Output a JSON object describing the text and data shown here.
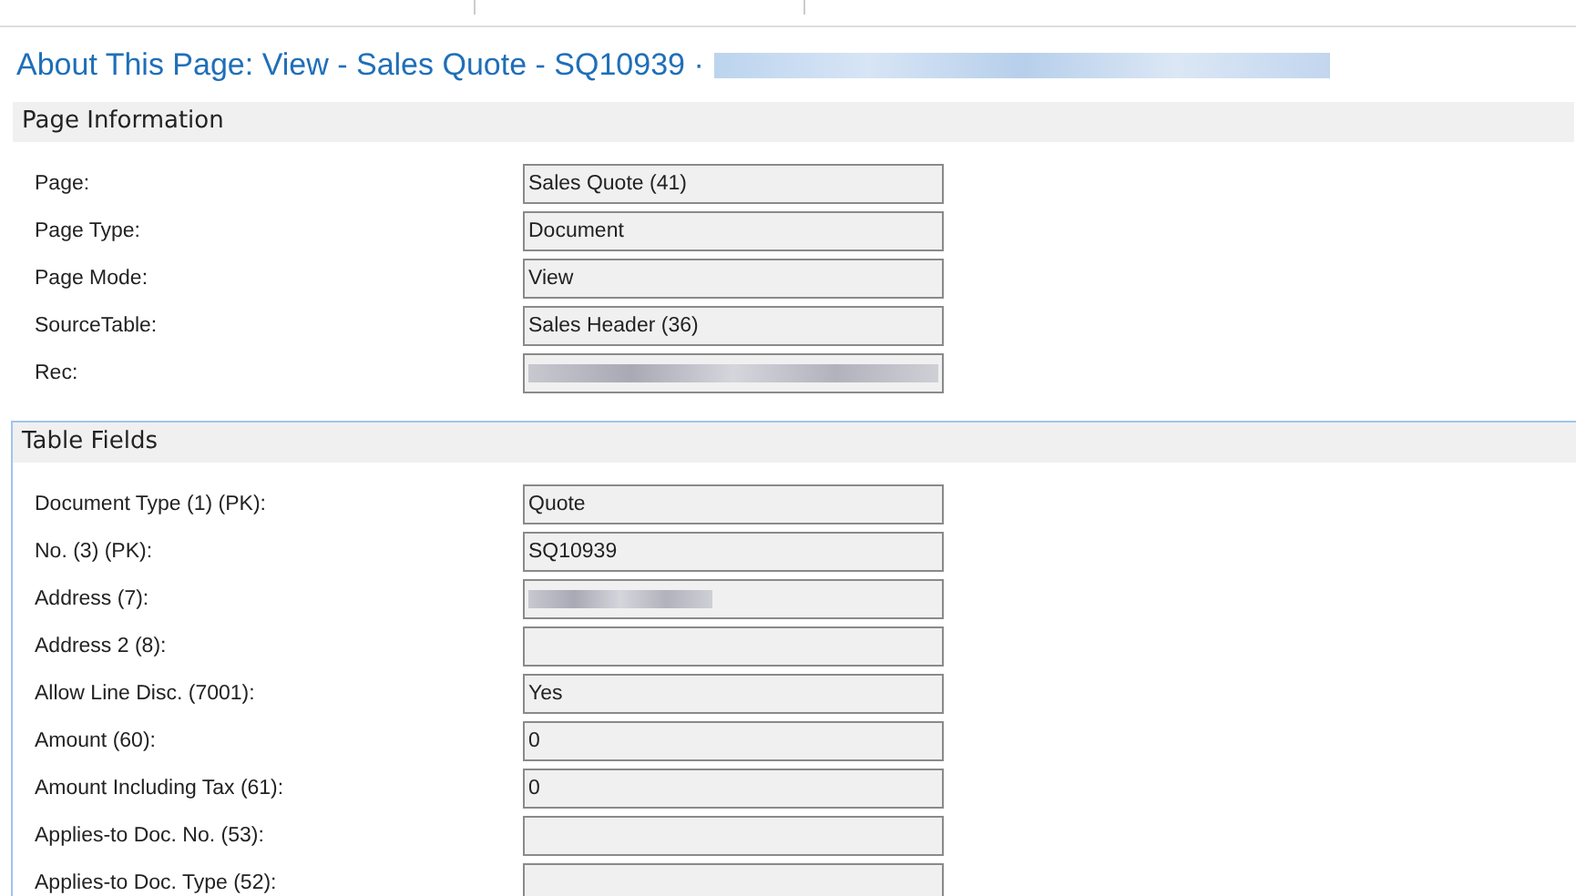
{
  "title": {
    "text": "About This Page: View - Sales Quote - SQ10939 ·",
    "redacted": true
  },
  "sections": [
    {
      "title": "Page Information",
      "focused": false,
      "fields": [
        {
          "label": "Page:",
          "value": "Sales Quote (41)",
          "redacted": false
        },
        {
          "label": "Page Type:",
          "value": "Document",
          "redacted": false
        },
        {
          "label": "Page Mode:",
          "value": "View",
          "redacted": false
        },
        {
          "label": "SourceTable:",
          "value": "Sales Header (36)",
          "redacted": false
        },
        {
          "label": "Rec:",
          "redacted": true
        }
      ]
    },
    {
      "title": "Table Fields",
      "focused": true,
      "fields": [
        {
          "label": "Document Type (1) (PK):",
          "value": "Quote",
          "redacted": false
        },
        {
          "label": "No. (3) (PK):",
          "value": "SQ10939",
          "redacted": false
        },
        {
          "label": "Address (7):",
          "redacted": true
        },
        {
          "label": "Address 2 (8):",
          "redacted": false
        },
        {
          "label": "Allow Line Disc. (7001):",
          "value": "Yes",
          "redacted": false
        },
        {
          "label": "Amount (60):",
          "value": "0",
          "redacted": false
        },
        {
          "label": "Amount Including Tax (61):",
          "value": "0",
          "redacted": false
        },
        {
          "label": "Applies-to Doc. No. (53):",
          "redacted": false
        },
        {
          "label": "Applies-to Doc. Type (52):",
          "redacted": false
        }
      ]
    }
  ]
}
